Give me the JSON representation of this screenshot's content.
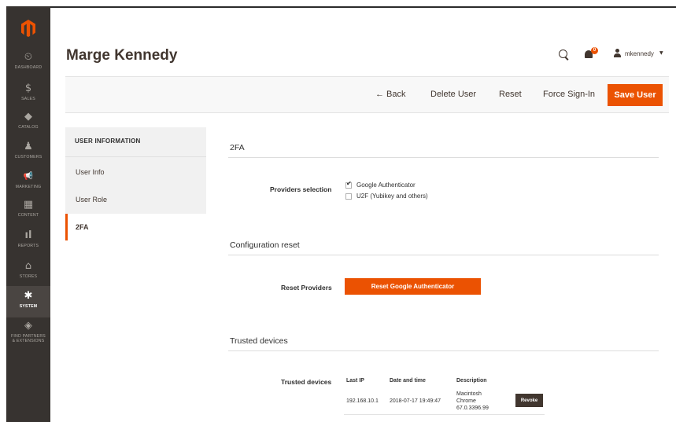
{
  "sidebar": {
    "logo": "magento-logo-icon",
    "items": [
      {
        "label": "DASHBOARD",
        "icon": "⏲",
        "icon_name": "dashboard-icon"
      },
      {
        "label": "SALES",
        "icon": "$",
        "icon_name": "dollar-icon"
      },
      {
        "label": "CATALOG",
        "icon": "◆",
        "icon_name": "cube-icon"
      },
      {
        "label": "CUSTOMERS",
        "icon": "♟",
        "icon_name": "person-icon"
      },
      {
        "label": "MARKETING",
        "icon": "📢",
        "icon_name": "megaphone-icon"
      },
      {
        "label": "CONTENT",
        "icon": "▦",
        "icon_name": "layout-icon"
      },
      {
        "label": "REPORTS",
        "icon": "ıl",
        "icon_name": "bar-chart-icon"
      },
      {
        "label": "STORES",
        "icon": "⌂",
        "icon_name": "store-icon"
      },
      {
        "label": "SYSTEM",
        "icon": "✱",
        "icon_name": "gear-icon"
      },
      {
        "label": "FIND PARTNERS & EXTENSIONS",
        "icon": "◈",
        "icon_name": "box-icon"
      }
    ],
    "active": "SYSTEM"
  },
  "header": {
    "title": "Marge Kennedy",
    "notifications_count": "0",
    "username": "mkennedy"
  },
  "actions": {
    "back": "← Back",
    "delete": "Delete User",
    "reset": "Reset",
    "force_signin": "Force Sign-In",
    "save": "Save User"
  },
  "tabs": {
    "title": "USER INFORMATION",
    "items": [
      "User Info",
      "User Role",
      "2FA"
    ],
    "active": "2FA"
  },
  "twofa": {
    "section_title": "2FA",
    "providers_label": "Providers selection",
    "providers": [
      {
        "label": "Google Authenticator",
        "checked": true
      },
      {
        "label": "U2F (Yubikey and others)",
        "checked": false
      }
    ]
  },
  "config_reset": {
    "section_title": "Configuration reset",
    "label": "Reset Providers",
    "button": "Reset Google Authenticator"
  },
  "trusted": {
    "section_title": "Trusted devices",
    "label": "Trusted devices",
    "columns": [
      "Last IP",
      "Date and time",
      "Description"
    ],
    "rows": [
      {
        "ip": "192.168.10.1",
        "datetime": "2018-07-17 19:49:47",
        "description": [
          "Macintosh",
          "Chrome",
          "67.0.3396.99"
        ],
        "action": "Revoke"
      }
    ]
  },
  "colors": {
    "accent": "#eb5202",
    "sidebar": "#373330",
    "text": "#41362f"
  }
}
